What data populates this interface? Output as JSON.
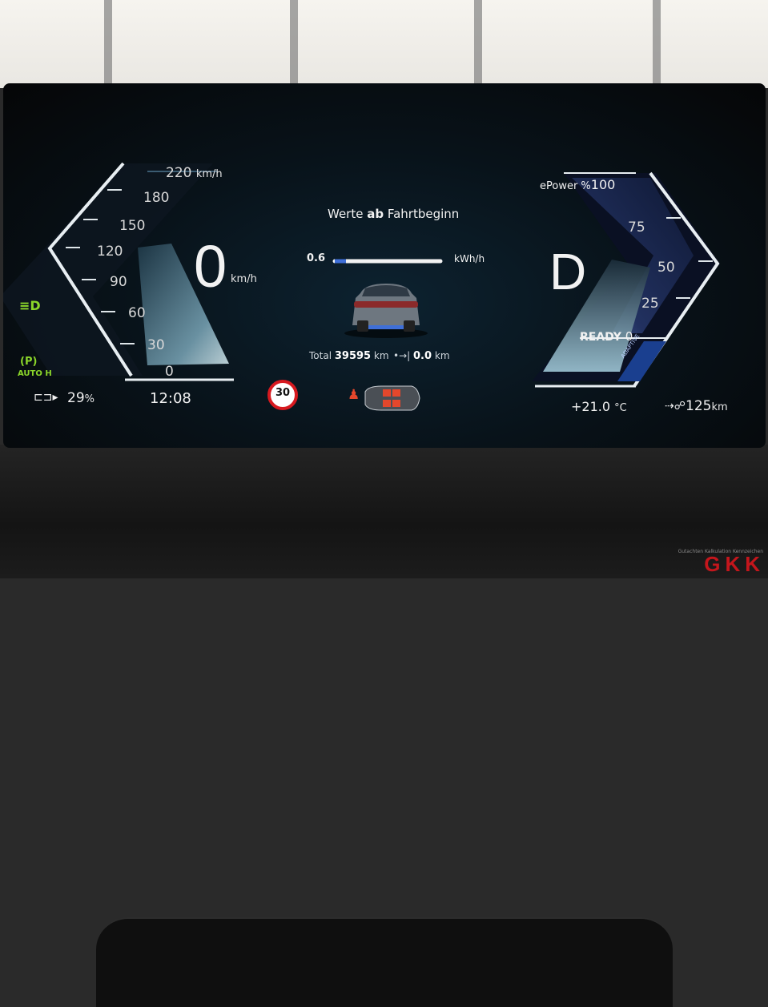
{
  "speedometer": {
    "ticks": [
      "220",
      "180",
      "150",
      "120",
      "90",
      "60",
      "30",
      "0"
    ],
    "top_unit": "km/h",
    "speed": "0",
    "speed_unit": "km/h"
  },
  "power_meter": {
    "title": "ePower %",
    "max": "100",
    "ticks": [
      "75",
      "50",
      "25"
    ],
    "ready_label": "READY",
    "zero": "0",
    "mode_badge": "ADAPTIVE",
    "gear": "D"
  },
  "center": {
    "title_pre": "Werte ",
    "title_bold": "ab",
    "title_post": " Fahrtbeginn",
    "consumption_value": "0.6",
    "consumption_unit": "kWh/h",
    "total_label": "Total",
    "total_value": "39595",
    "total_unit": "km",
    "trip_value": "0.0",
    "trip_unit": "km"
  },
  "status_bar": {
    "battery_percent": "29",
    "battery_unit": "%",
    "time": "12:08",
    "speed_limit": "30",
    "outside_temp": "+21.0",
    "temp_unit": "°C",
    "range": "125",
    "range_unit": "km",
    "auto_hold_label": "AUTO H"
  },
  "watermark": {
    "text": "GKK",
    "sub": "Gutachten Kalkulation Kennzeichen"
  },
  "colors": {
    "indicator_green": "#8bd62a",
    "speed_limit_red": "#d7191f",
    "accent_blue": "#3f6fd8",
    "seatbelt_red": "#e4472c"
  }
}
